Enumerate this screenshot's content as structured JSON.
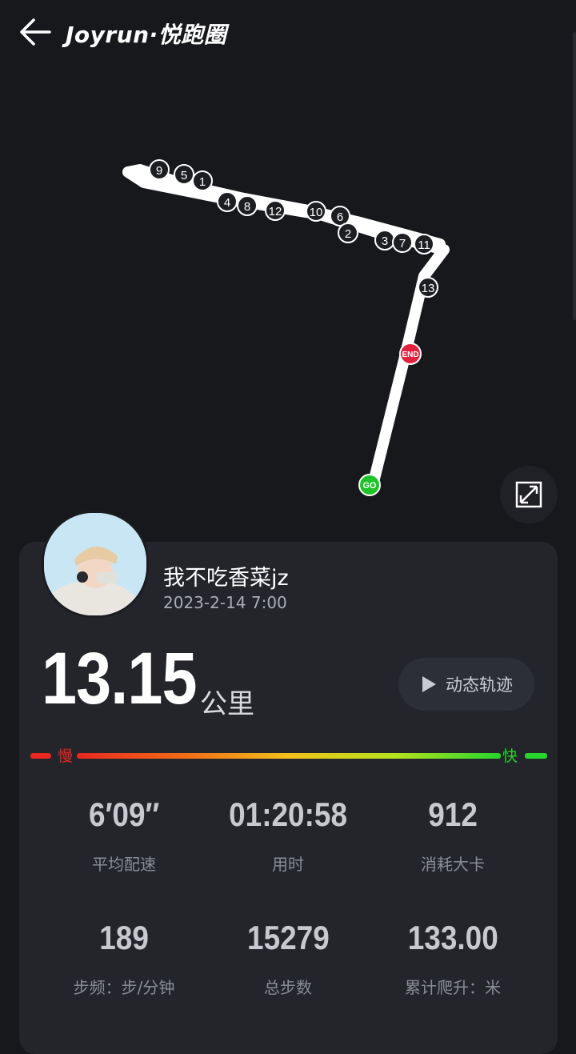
{
  "header": {
    "title": "Joyrun·悦跑圈"
  },
  "map": {
    "start_marker": "GO",
    "end_marker": "END",
    "split_markers": [
      "9",
      "5",
      "1",
      "4",
      "8",
      "12",
      "10",
      "6",
      "2",
      "3",
      "7",
      "11",
      "13"
    ]
  },
  "profile": {
    "username": "我不吃香菜jz",
    "datetime": "2023-2-14 7:00"
  },
  "summary": {
    "distance": "13.15",
    "unit": "公里"
  },
  "replay": {
    "label": "动态轨迹"
  },
  "pace_scale": {
    "slow": "慢",
    "fast": "快"
  },
  "stats": [
    {
      "value": "6′09′′",
      "label": "平均配速"
    },
    {
      "value": "01:20:58",
      "label": "用时"
    },
    {
      "value": "912",
      "label": "消耗大卡"
    },
    {
      "value": "189",
      "label": "步频：步/分钟"
    },
    {
      "value": "15279",
      "label": "总步数"
    },
    {
      "value": "133.00",
      "label": "累计爬升：米"
    }
  ],
  "colors": {
    "background": "#17181c",
    "card": "#23252b",
    "go": "#1fc32a",
    "end": "#e0223f",
    "route": "#ffffff"
  }
}
